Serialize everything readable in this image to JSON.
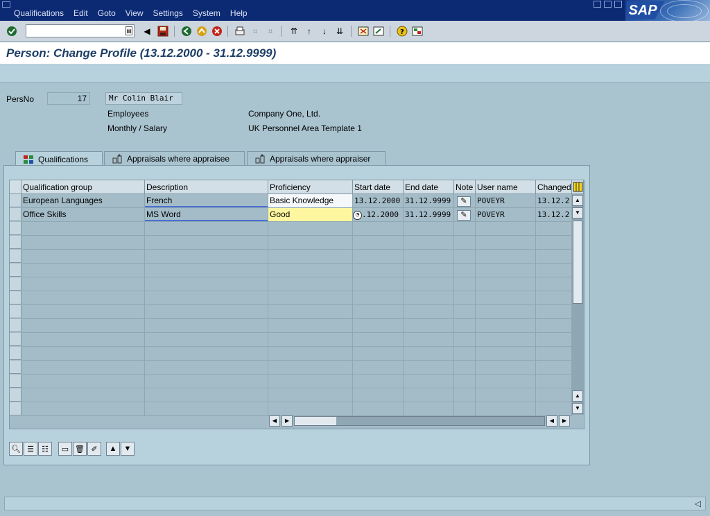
{
  "menu": {
    "items": [
      "Qualifications",
      "Edit",
      "Goto",
      "View",
      "Settings",
      "System",
      "Help"
    ],
    "logo": "SAP"
  },
  "toolbar": {
    "command_value": "",
    "icons": [
      "enter-icon",
      "save-icon",
      "back-icon",
      "exit-icon",
      "cancel-icon",
      "print-icon",
      "find-icon",
      "find-next-icon",
      "first-page-icon",
      "prev-page-icon",
      "next-page-icon",
      "last-page-icon",
      "new-session-icon",
      "shortcut-icon",
      "help-icon",
      "layout-icon"
    ]
  },
  "title": "Person: Change Profile (13.12.2000 - 31.12.9999)",
  "header": {
    "persno_label": "PersNo",
    "persno_value": "17",
    "name": "Mr Colin Blair",
    "group": "Employees",
    "company": "Company One, Ltd.",
    "subgroup": "Monthly / Salary",
    "area": "UK Personnel Area Template 1"
  },
  "tabs": [
    {
      "label": "Qualifications",
      "active": true
    },
    {
      "label": "Appraisals where appraisee",
      "active": false
    },
    {
      "label": "Appraisals where appraiser",
      "active": false
    }
  ],
  "table": {
    "columns": [
      "Qualification group",
      "Description",
      "Proficiency",
      "Start date",
      "End date",
      "Note",
      "User name",
      "Changed"
    ],
    "rows": [
      {
        "group": "European Languages",
        "description": "French",
        "proficiency": "Basic Knowledge",
        "start": "13.12.2000",
        "end": "31.12.9999",
        "user": "POVEYR",
        "changed": "13.12.2"
      },
      {
        "group": "Office Skills",
        "description": "MS Word",
        "proficiency": "Good",
        "start": ".12.2000",
        "end": "31.12.9999",
        "user": "POVEYR",
        "changed": "13.12.2"
      }
    ]
  },
  "colors": {
    "menubar": "#0c2a73",
    "background": "#a9c3cf",
    "title_text": "#1d3f66",
    "highlight": "#fff7a0"
  }
}
